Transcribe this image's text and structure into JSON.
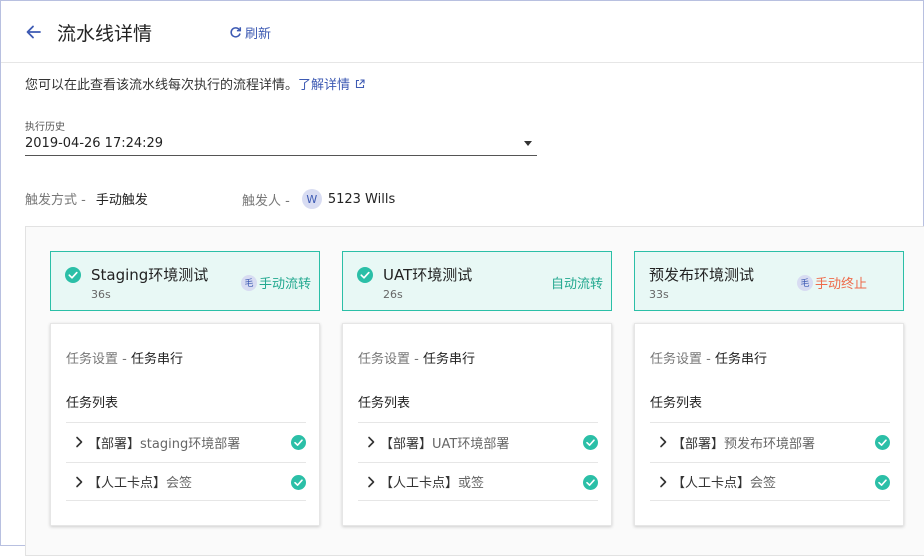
{
  "header": {
    "title": "流水线详情",
    "refresh_label": "刷新"
  },
  "description": {
    "text": "您可以在此查看该流水线每次执行的流程详情。",
    "link": "了解详情"
  },
  "history": {
    "label": "执行历史",
    "value": "2019-04-26 17:24:29"
  },
  "trigger": {
    "mode_label": "触发方式 -",
    "mode_value": "手动触发",
    "person_label": "触发人 -",
    "avatar_letter": "W",
    "person_value": "5123 Wills"
  },
  "colors": {
    "accent": "#2bbfa7",
    "link": "#3d5ab3",
    "stop": "#ee6a4a"
  },
  "stages": [
    {
      "name": "Staging环境测试",
      "duration": "36s",
      "op_avatar": "毛",
      "action": "手动流转",
      "action_type": "manual-pass",
      "setting_label": "任务设置 -",
      "setting_value": "任务串行",
      "list_title": "任务列表",
      "tasks": [
        {
          "tag": "【部署】",
          "name": "staging环境部署",
          "status": "success"
        },
        {
          "tag": "【人工卡点】",
          "name": "会签",
          "status": "success"
        }
      ]
    },
    {
      "name": "UAT环境测试",
      "duration": "26s",
      "op_avatar": "",
      "action": "自动流转",
      "action_type": "auto-pass",
      "setting_label": "任务设置 -",
      "setting_value": "任务串行",
      "list_title": "任务列表",
      "tasks": [
        {
          "tag": "【部署】",
          "name": "UAT环境部署",
          "status": "success"
        },
        {
          "tag": "【人工卡点】",
          "name": "或签",
          "status": "success"
        }
      ]
    },
    {
      "name": "预发布环境测试",
      "duration": "33s",
      "op_avatar": "毛",
      "action": "手动终止",
      "action_type": "manual-stop",
      "setting_label": "任务设置 -",
      "setting_value": "任务串行",
      "list_title": "任务列表",
      "tasks": [
        {
          "tag": "【部署】",
          "name": "预发布环境部署",
          "status": "success"
        },
        {
          "tag": "【人工卡点】",
          "name": "会签",
          "status": "success"
        }
      ]
    }
  ]
}
